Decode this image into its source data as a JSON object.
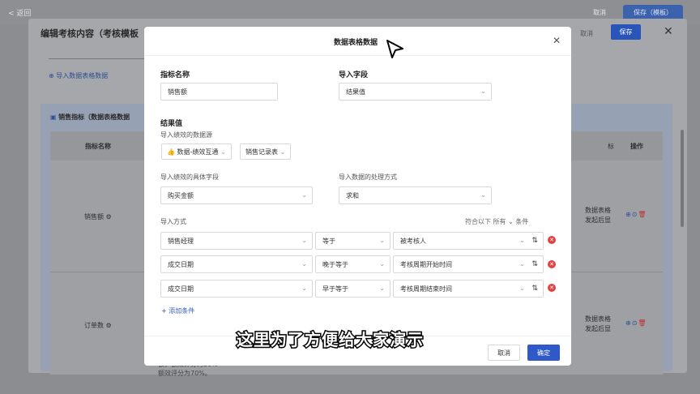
{
  "topbar": {
    "back": "< 返回",
    "cancel": "取消",
    "save": "保存（模板）"
  },
  "panel": {
    "title": "编辑考核内容（考核模板",
    "cancel": "取消",
    "save": "保存",
    "import_link": "导入数据表格数据",
    "section_title": "销售指标（数据表格数据",
    "table": {
      "col_name": "指标名称",
      "col_m": "标",
      "col_ops": "操作",
      "rows": [
        {
          "name": "销售额",
          "info1": "数据表格",
          "info2": "发起后显"
        },
        {
          "name": "订单数",
          "info1": "数据表格",
          "info2": "发起后显"
        }
      ]
    },
    "bottom_text1": "额，额效评分为50%",
    "bottom_text2": "额效评分为70%。"
  },
  "modal": {
    "title": "数据表格数据",
    "indicator_label": "指标名称",
    "indicator_value": "销售额",
    "import_field_label": "导入字段",
    "import_field_value": "结果值",
    "result_label": "结果值",
    "source_label": "导入绩效的数据源",
    "source_tag1": "数据-绩效互通",
    "source_tag2": "销售记录表",
    "specific_field_label": "导入绩效的具体字段",
    "specific_field_value": "购买金额",
    "process_label": "导入数据的处理方式",
    "process_value": "求和",
    "mode_label": "导入方式",
    "logic_text": "符合以下 所有",
    "logic_suffix": "条件",
    "conditions": [
      {
        "field": "销售经理",
        "op": "等于",
        "value": "被考核人"
      },
      {
        "field": "成交日期",
        "op": "晚于等于",
        "value": "考核周期开始时间"
      },
      {
        "field": "成交日期",
        "op": "早于等于",
        "value": "考核周期结束时间"
      }
    ],
    "add_condition": "+ 添加条件",
    "cancel": "取消",
    "ok": "确定"
  },
  "caption": "这里为了方便给大家演示",
  "colors": {
    "primary": "#2f59c8",
    "danger": "#e04343"
  }
}
